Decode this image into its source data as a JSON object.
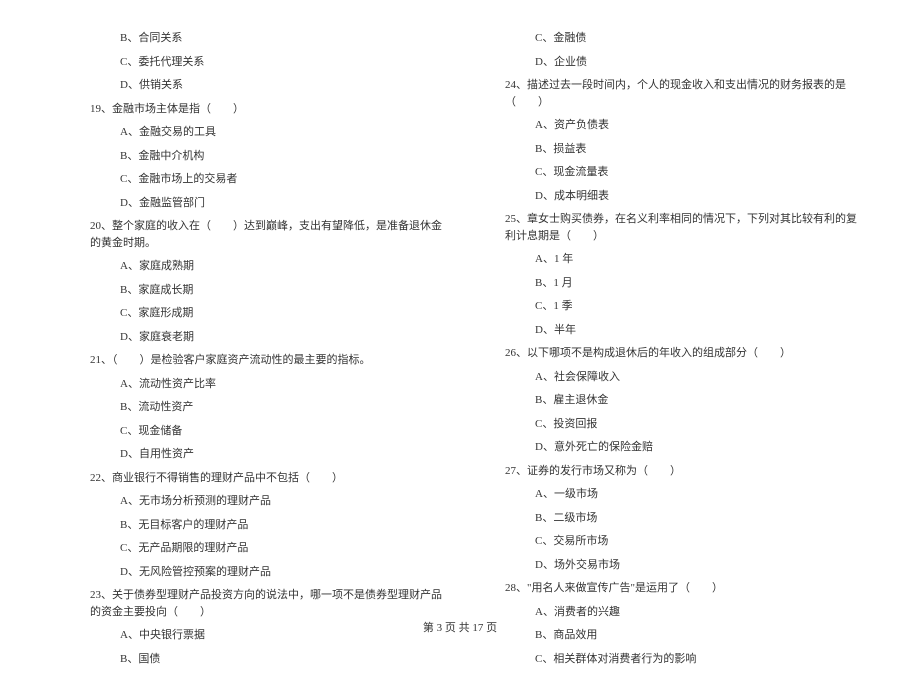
{
  "left_column": [
    {
      "type": "option",
      "prefix": "B、",
      "text": "合同关系"
    },
    {
      "type": "option",
      "prefix": "C、",
      "text": "委托代理关系"
    },
    {
      "type": "option",
      "prefix": "D、",
      "text": "供销关系"
    },
    {
      "type": "question",
      "num": "19、",
      "text": "金融市场主体是指（　　）"
    },
    {
      "type": "option",
      "prefix": "A、",
      "text": "金融交易的工具"
    },
    {
      "type": "option",
      "prefix": "B、",
      "text": "金融中介机构"
    },
    {
      "type": "option",
      "prefix": "C、",
      "text": "金融市场上的交易者"
    },
    {
      "type": "option",
      "prefix": "D、",
      "text": "金融监管部门"
    },
    {
      "type": "question",
      "num": "20、",
      "text": "整个家庭的收入在（　　）达到巅峰，支出有望降低，是准备退休金的黄金时期。"
    },
    {
      "type": "option",
      "prefix": "A、",
      "text": "家庭成熟期"
    },
    {
      "type": "option",
      "prefix": "B、",
      "text": "家庭成长期"
    },
    {
      "type": "option",
      "prefix": "C、",
      "text": "家庭形成期"
    },
    {
      "type": "option",
      "prefix": "D、",
      "text": "家庭衰老期"
    },
    {
      "type": "question",
      "num": "21、",
      "text": "（　　）是检验客户家庭资产流动性的最主要的指标。"
    },
    {
      "type": "option",
      "prefix": "A、",
      "text": "流动性资产比率"
    },
    {
      "type": "option",
      "prefix": "B、",
      "text": "流动性资产"
    },
    {
      "type": "option",
      "prefix": "C、",
      "text": "现金储备"
    },
    {
      "type": "option",
      "prefix": "D、",
      "text": "自用性资产"
    },
    {
      "type": "question",
      "num": "22、",
      "text": "商业银行不得销售的理财产品中不包括（　　）"
    },
    {
      "type": "option",
      "prefix": "A、",
      "text": "无市场分析预测的理财产品"
    },
    {
      "type": "option",
      "prefix": "B、",
      "text": "无目标客户的理财产品"
    },
    {
      "type": "option",
      "prefix": "C、",
      "text": "无产品期限的理财产品"
    },
    {
      "type": "option",
      "prefix": "D、",
      "text": "无风险管控预案的理财产品"
    },
    {
      "type": "question",
      "num": "23、",
      "text": "关于债券型理财产品投资方向的说法中，哪一项不是债券型理财产品的资金主要投向（　　）"
    },
    {
      "type": "option",
      "prefix": "A、",
      "text": "中央银行票据"
    },
    {
      "type": "option",
      "prefix": "B、",
      "text": "国债"
    }
  ],
  "right_column": [
    {
      "type": "option",
      "prefix": "C、",
      "text": "金融债"
    },
    {
      "type": "option",
      "prefix": "D、",
      "text": "企业债"
    },
    {
      "type": "question",
      "num": "24、",
      "text": "描述过去一段时间内，个人的现金收入和支出情况的财务报表的是（　　）"
    },
    {
      "type": "option",
      "prefix": "A、",
      "text": "资产负债表"
    },
    {
      "type": "option",
      "prefix": "B、",
      "text": "损益表"
    },
    {
      "type": "option",
      "prefix": "C、",
      "text": "现金流量表"
    },
    {
      "type": "option",
      "prefix": "D、",
      "text": "成本明细表"
    },
    {
      "type": "question",
      "num": "25、",
      "text": "章女士购买债券，在名义利率相同的情况下，下列对其比较有利的复利计息期是（　　）"
    },
    {
      "type": "option",
      "prefix": "A、",
      "text": "1 年"
    },
    {
      "type": "option",
      "prefix": "B、",
      "text": "1 月"
    },
    {
      "type": "option",
      "prefix": "C、",
      "text": "1 季"
    },
    {
      "type": "option",
      "prefix": "D、",
      "text": "半年"
    },
    {
      "type": "question",
      "num": "26、",
      "text": "以下哪项不是构成退休后的年收入的组成部分（　　）"
    },
    {
      "type": "option",
      "prefix": "A、",
      "text": "社会保障收入"
    },
    {
      "type": "option",
      "prefix": "B、",
      "text": "雇主退休金"
    },
    {
      "type": "option",
      "prefix": "C、",
      "text": "投资回报"
    },
    {
      "type": "option",
      "prefix": "D、",
      "text": "意外死亡的保险金赔"
    },
    {
      "type": "question",
      "num": "27、",
      "text": "证券的发行市场又称为（　　）"
    },
    {
      "type": "option",
      "prefix": "A、",
      "text": "一级市场"
    },
    {
      "type": "option",
      "prefix": "B、",
      "text": "二级市场"
    },
    {
      "type": "option",
      "prefix": "C、",
      "text": "交易所市场"
    },
    {
      "type": "option",
      "prefix": "D、",
      "text": "场外交易市场"
    },
    {
      "type": "question",
      "num": "28、",
      "text": "\"用名人来做宣传广告\"是运用了（　　）"
    },
    {
      "type": "option",
      "prefix": "A、",
      "text": "消费者的兴趣"
    },
    {
      "type": "option",
      "prefix": "B、",
      "text": "商品效用"
    },
    {
      "type": "option",
      "prefix": "C、",
      "text": "相关群体对消费者行为的影响"
    }
  ],
  "footer": {
    "text": "第 3 页 共 17 页"
  }
}
